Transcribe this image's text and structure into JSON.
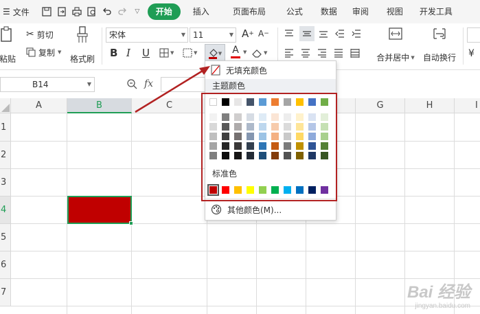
{
  "menubar": {
    "file_label": "文件",
    "tabs": [
      "开始",
      "插入",
      "页面布局",
      "公式",
      "数据",
      "审阅",
      "视图",
      "开发工具"
    ]
  },
  "ribbon": {
    "paste_label": "粘贴",
    "cut_label": "剪切",
    "copy_label": "复制",
    "format_painter_label": "格式刷",
    "font_name": "宋体",
    "font_size": "11",
    "merge_label": "合并居中",
    "wrap_label": "自动换行"
  },
  "formula_bar": {
    "cell_ref": "B14",
    "fx_label": "fx"
  },
  "grid": {
    "columns": [
      "A",
      "B",
      "C",
      "D",
      "E",
      "F",
      "G",
      "H",
      "I"
    ],
    "rows": [
      "1",
      "2",
      "3",
      "4",
      "5",
      "6",
      "7"
    ],
    "selected_column": "B",
    "selected_row": "4",
    "filled_cell_color": "#c00000"
  },
  "color_panel": {
    "no_fill_label": "无填充颜色",
    "theme_label": "主题颜色",
    "standard_label": "标准色",
    "more_colors_label": "其他颜色(M)...",
    "theme_top_row": [
      "#ffffff",
      "#000000",
      "#e7e6e6",
      "#44546a",
      "#5b9bd5",
      "#ed7d31",
      "#a5a5a5",
      "#ffc000",
      "#4472c4",
      "#70ad47"
    ],
    "theme_shades": [
      [
        "#f2f2f2",
        "#7f7f7f",
        "#d0cece",
        "#d6dce4",
        "#deebf6",
        "#fbe5d5",
        "#ededed",
        "#fff2cc",
        "#dae3f3",
        "#e2efd9"
      ],
      [
        "#d8d8d8",
        "#595959",
        "#aeabab",
        "#adb9ca",
        "#bdd7ee",
        "#f7cbac",
        "#dbdbdb",
        "#fee599",
        "#b4c6e7",
        "#c5e0b3"
      ],
      [
        "#bfbfbf",
        "#3f3f3f",
        "#757070",
        "#8496b0",
        "#9cc3e5",
        "#f4b183",
        "#c9c9c9",
        "#ffd965",
        "#8eaadb",
        "#a8d08d"
      ],
      [
        "#a5a5a5",
        "#262626",
        "#3a3838",
        "#323f4f",
        "#2e75b5",
        "#c55a11",
        "#7b7b7b",
        "#bf9000",
        "#2f5496",
        "#538135"
      ],
      [
        "#7f7f7f",
        "#0c0c0c",
        "#171616",
        "#222a35",
        "#1e4e79",
        "#833c0b",
        "#525252",
        "#7f6000",
        "#1f3864",
        "#375623"
      ]
    ],
    "standard_colors": [
      "#c00000",
      "#ff0000",
      "#ffc000",
      "#ffff00",
      "#92d050",
      "#00b050",
      "#00b0f0",
      "#0070c0",
      "#002060",
      "#7030a0"
    ]
  },
  "accent_colors": {
    "green": "#1f9d55",
    "annotation_red": "#b22222"
  },
  "watermark": {
    "brand": "Bai 经验",
    "url": "jingyan.baidu.com"
  }
}
